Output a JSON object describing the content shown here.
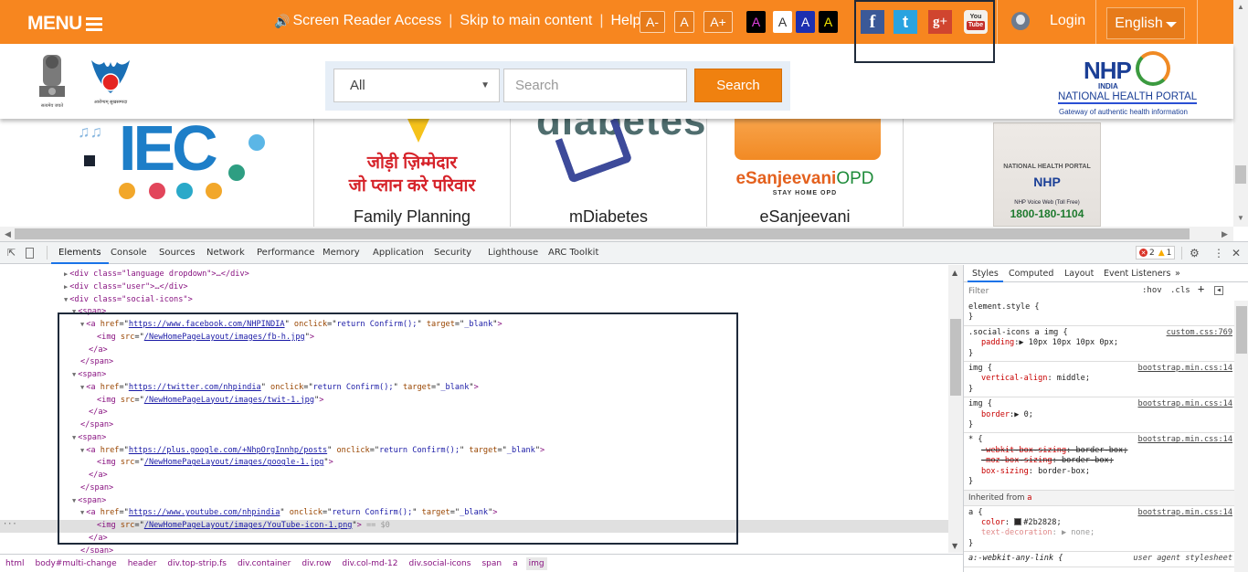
{
  "topbar": {
    "menu_label": "MENU",
    "screen_reader": "Screen Reader Access",
    "skip": "Skip to main content",
    "help": "Help",
    "font_sizes": [
      "A-",
      "A",
      "A+"
    ],
    "contrast_options": [
      {
        "label": "A",
        "bg": "#000000",
        "fg": "#e040e0"
      },
      {
        "label": "A",
        "bg": "#ffffff",
        "fg": "#333333"
      },
      {
        "label": "A",
        "bg": "#1c2fb0",
        "fg": "#ffffff"
      },
      {
        "label": "A",
        "bg": "#000000",
        "fg": "#f5e600"
      }
    ],
    "social": [
      {
        "name": "facebook",
        "glyph": "f",
        "color": "#3b5998"
      },
      {
        "name": "twitter",
        "glyph": "t",
        "color": "#2aa3e0"
      },
      {
        "name": "google-plus",
        "glyph": "g+",
        "color": "#d0452f"
      },
      {
        "name": "youtube",
        "glyph": "You Tube",
        "color": "#c4302b"
      }
    ],
    "login": "Login",
    "language": "English",
    "accent": "#f7861f"
  },
  "header": {
    "emblem_caption": "सत्यमेव जयते",
    "nhm_caption": "आरोग्यम् सुखसम्पदा",
    "search": {
      "category_selected": "All",
      "placeholder": "Search",
      "button": "Search"
    },
    "nhp_logo": {
      "title": "NHP",
      "sub": "INDIA",
      "name": "NATIONAL HEALTH PORTAL",
      "tagline": "Gateway of authentic health information"
    }
  },
  "cards": [
    {
      "title": "",
      "image_text": "IEC"
    },
    {
      "title": "Family Planning",
      "image_text_line1": "जोड़ी ज़िम्मेदार",
      "image_text_line2": "जो प्लान करे परिवार"
    },
    {
      "title": "mDiabetes",
      "image_text": "diabetes"
    },
    {
      "title": "eSanjeevani",
      "logo_a": "eSanjeevani",
      "logo_b": "OPD",
      "logo_sub": "STAY HOME OPD"
    },
    {
      "title": "",
      "kiosk_portal": "NATIONAL HEALTH PORTAL",
      "kiosk_logo": "NHP",
      "kiosk_voice": "NHP Voice Web (Toll Free)",
      "kiosk_number": "1800-180-1104"
    }
  ],
  "devtools": {
    "tabs": [
      "Elements",
      "Console",
      "Sources",
      "Network",
      "Performance",
      "Memory",
      "Application",
      "Security",
      "Lighthouse",
      "ARC Toolkit"
    ],
    "active_tab": "Elements",
    "errors": "2",
    "warnings": "1",
    "dom_lines": [
      {
        "indent": 0,
        "tri": "▶",
        "html": "<div class=\"language dropdown\">…</div>"
      },
      {
        "indent": 0,
        "tri": "▶",
        "html": "<div class=\"user\">…</div>"
      },
      {
        "indent": 0,
        "tri": "▼",
        "html": "<div class=\"social-icons\">"
      },
      {
        "indent": 1,
        "tri": "▼",
        "html": "<span>"
      },
      {
        "indent": 2,
        "tri": "▼",
        "a_href": "https://www.facebook.com/NHPINDIA"
      },
      {
        "indent": 3,
        "img_src": "/NewHomePageLayout/images/fb-h.jpg"
      },
      {
        "indent": 2,
        "html": "</a>"
      },
      {
        "indent": 1,
        "html": "</span>"
      },
      {
        "indent": 1,
        "tri": "▼",
        "html": "<span>"
      },
      {
        "indent": 2,
        "tri": "▼",
        "a_href": "https://twitter.com/nhpindia"
      },
      {
        "indent": 3,
        "img_src": "/NewHomePageLayout/images/twit-1.jpg"
      },
      {
        "indent": 2,
        "html": "</a>"
      },
      {
        "indent": 1,
        "html": "</span>"
      },
      {
        "indent": 1,
        "tri": "▼",
        "html": "<span>"
      },
      {
        "indent": 2,
        "tri": "▼",
        "a_href": "https://plus.google.com/+NhpOrgInnhp/posts"
      },
      {
        "indent": 3,
        "img_src": "/NewHomePageLayout/images/google-1.jpg"
      },
      {
        "indent": 2,
        "html": "</a>"
      },
      {
        "indent": 1,
        "html": "</span>"
      },
      {
        "indent": 1,
        "tri": "▼",
        "html": "<span>"
      },
      {
        "indent": 2,
        "tri": "▼",
        "a_href": "https://www.youtube.com/nhpindia"
      },
      {
        "indent": 3,
        "img_src": "/NewHomePageLayout/images/YouTube-icon-1.png",
        "selected": true
      },
      {
        "indent": 2,
        "html": "</a>"
      },
      {
        "indent": 1,
        "html": "</span>"
      }
    ],
    "a_onclick": "return Confirm();",
    "a_target": "_blank",
    "selected_marker": "== $0",
    "breadcrumbs": [
      "html",
      "body#multi-change",
      "header",
      "div.top-strip.fs",
      "div.container",
      "div.row",
      "div.col-md-12",
      "div.social-icons",
      "span",
      "a",
      "img"
    ],
    "styles_tabs": [
      "Styles",
      "Computed",
      "Layout",
      "Event Listeners",
      "»"
    ],
    "filter_placeholder": "Filter",
    "hov": ":hov",
    "cls": ".cls",
    "rules": [
      {
        "selector": "element.style {",
        "source": "",
        "props": []
      },
      {
        "selector": ".social-icons a img {",
        "source": "custom.css:769",
        "props": [
          {
            "name": "padding",
            "value": "▶ 10px 10px 10px 0px;"
          }
        ]
      },
      {
        "selector": "img {",
        "source": "bootstrap.min.css:14",
        "props": [
          {
            "name": "vertical-align",
            "value": " middle;"
          }
        ]
      },
      {
        "selector": "img {",
        "source": "bootstrap.min.css:14",
        "props": [
          {
            "name": "border",
            "value": "▶ 0;"
          }
        ]
      },
      {
        "selector": "* {",
        "source": "bootstrap.min.css:14",
        "props": [
          {
            "name": "-webkit-box-sizing",
            "value": " border-box;",
            "struck": true
          },
          {
            "name": "-moz-box-sizing",
            "value": " border-box;",
            "struck": true
          },
          {
            "name": "box-sizing",
            "value": " border-box;"
          }
        ]
      }
    ],
    "inherited_label": "Inherited from",
    "inherited_from": "a",
    "inherited_rule": {
      "selector": "a {",
      "source": "bootstrap.min.css:14",
      "color_name": "color",
      "color_value": "#2b2828;",
      "td_name": "text-decoration",
      "td_value": "▶ none;"
    },
    "next_rule_selector": "a:-webkit-any-link {",
    "next_rule_source": "user agent stylesheet"
  }
}
